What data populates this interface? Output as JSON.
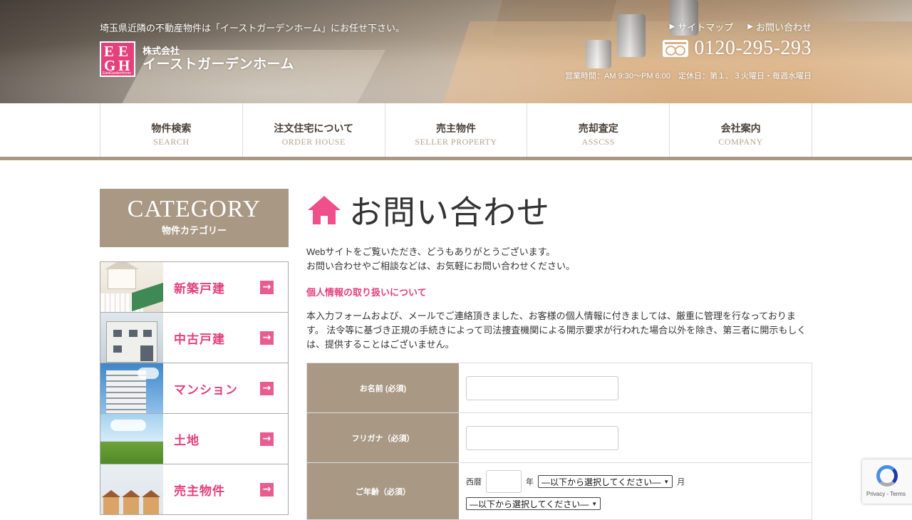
{
  "header": {
    "tagline": "埼玉県近隣の不動産物件は「イーストガーデンホーム」にお任せ下さい。",
    "logo": {
      "mark_letters": [
        "E",
        "G",
        "H"
      ],
      "mark_caption": "EastGardenHome",
      "line1": "株式会社",
      "line2": "イーストガーデンホーム"
    },
    "links": [
      {
        "icon": "play-triangle-icon",
        "label": "サイトマップ"
      },
      {
        "icon": "play-triangle-icon",
        "label": "お問い合わせ"
      }
    ],
    "freedial_icon": "freedial-icon",
    "phone": "0120-295-293",
    "hours": "営業時間：AM 9:30～PM 6:00　定休日：第１、３火曜日・毎週水曜日"
  },
  "nav": [
    {
      "jp": "物件検索",
      "en": "SEARCH"
    },
    {
      "jp": "注文住宅について",
      "en": "ORDER HOUSE"
    },
    {
      "jp": "売主物件",
      "en": "SELLER PROPERTY"
    },
    {
      "jp": "売却査定",
      "en": "ASSCSS"
    },
    {
      "jp": "会社案内",
      "en": "COMPANY"
    }
  ],
  "sidebar": {
    "heading_en": "CATEGORY",
    "heading_jp": "物件カテゴリー",
    "items": [
      {
        "label": "新築戸建",
        "arrow": "→"
      },
      {
        "label": "中古戸建",
        "arrow": "→"
      },
      {
        "label": "マンション",
        "arrow": "→"
      },
      {
        "label": "土地",
        "arrow": "→"
      },
      {
        "label": "売主物件",
        "arrow": "→"
      }
    ]
  },
  "main": {
    "title": "お問い合わせ",
    "title_icon": "home-icon",
    "intro_line1": "Webサイトをご覧いただき、どうもありがとうございます。",
    "intro_line2": "お問い合わせやご相談などは、お気軽にお問い合わせください。",
    "privacy_heading": "個人情報の取り扱いについて",
    "privacy_text": "本入力フォームおよび、メールでご連絡頂きました、お客様の個人情報に付きましては、厳重に管理を行なっております。 法令等に基づき正規の手続きによって司法捜査機関による開示要求が行われた場合以外を除き、第三者に開示もしくは、提供することはございません。"
  },
  "form": {
    "name_label": "お名前 (必須)",
    "name_value": "",
    "kana_label": "フリガナ（必須）",
    "kana_value": "",
    "age_label": "ご年齢（必須）",
    "era_label": "西暦",
    "year_value": "",
    "year_unit": "年",
    "month_unit": "月",
    "month_select": "―以下から選択してください―",
    "day_select": "―以下から選択してください―"
  },
  "recaptcha": {
    "text": "Privacy - Terms"
  },
  "colors": {
    "accent_pink": "#e4407a",
    "brown": "#a89884"
  }
}
